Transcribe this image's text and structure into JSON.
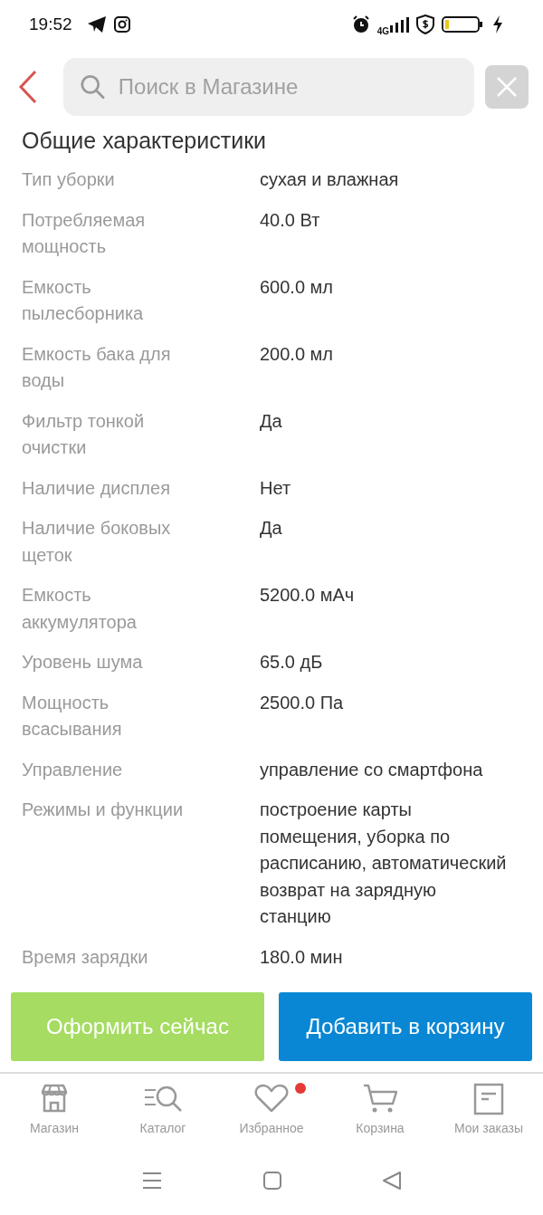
{
  "status_bar": {
    "time": "19:52",
    "network": "4G"
  },
  "search": {
    "placeholder": "Поиск в Магазине"
  },
  "section": {
    "title": "Общие характеристики"
  },
  "specs": [
    {
      "label": "Тип уборки",
      "value": "сухая и влажная"
    },
    {
      "label": "Потребляемая мощность",
      "value": "40.0 Вт"
    },
    {
      "label": "Емкость пылесборника",
      "value": "600.0 мл"
    },
    {
      "label": "Емкость бака для воды",
      "value": "200.0 мл"
    },
    {
      "label": "Фильтр тонкой очистки",
      "value": "Да"
    },
    {
      "label": "Наличие дисплея",
      "value": "Нет"
    },
    {
      "label": "Наличие боковых щеток",
      "value": "Да"
    },
    {
      "label": "Емкость аккумулятора",
      "value": "5200.0 мАч"
    },
    {
      "label": "Уровень шума",
      "value": "65.0 дБ"
    },
    {
      "label": "Мощность всасывания",
      "value": "2500.0 Па"
    },
    {
      "label": "Управление",
      "value": "управление со смартфона"
    },
    {
      "label": "Режимы и функции",
      "value": "построение карты помещения, уборка по расписанию, автоматический возврат на зарядную станцию"
    },
    {
      "label": "Время зарядки",
      "value": "180.0 мин"
    }
  ],
  "actions": [
    {
      "label": "Оформить сейчас",
      "kind": "buy"
    },
    {
      "label": "Добавить в корзину",
      "kind": "cart"
    }
  ],
  "tabs": [
    {
      "label": "Магазин",
      "kind": "store",
      "badge": false
    },
    {
      "label": "Каталог",
      "kind": "catalog",
      "badge": false
    },
    {
      "label": "Избранное",
      "kind": "favorites",
      "badge": true
    },
    {
      "label": "Корзина",
      "kind": "cart",
      "badge": false
    },
    {
      "label": "Мои заказы",
      "kind": "orders",
      "badge": false
    }
  ]
}
